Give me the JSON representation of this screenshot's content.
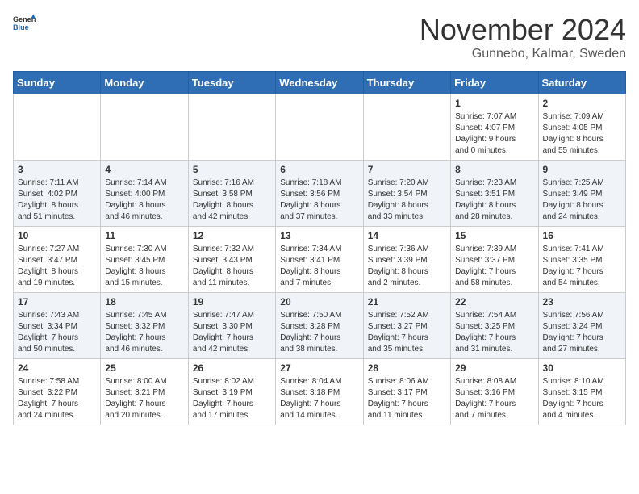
{
  "header": {
    "logo_general": "General",
    "logo_blue": "Blue",
    "month_title": "November 2024",
    "location": "Gunnebo, Kalmar, Sweden"
  },
  "columns": [
    "Sunday",
    "Monday",
    "Tuesday",
    "Wednesday",
    "Thursday",
    "Friday",
    "Saturday"
  ],
  "weeks": [
    [
      {
        "date": "",
        "info": ""
      },
      {
        "date": "",
        "info": ""
      },
      {
        "date": "",
        "info": ""
      },
      {
        "date": "",
        "info": ""
      },
      {
        "date": "",
        "info": ""
      },
      {
        "date": "1",
        "info": "Sunrise: 7:07 AM\nSunset: 4:07 PM\nDaylight: 9 hours\nand 0 minutes."
      },
      {
        "date": "2",
        "info": "Sunrise: 7:09 AM\nSunset: 4:05 PM\nDaylight: 8 hours\nand 55 minutes."
      }
    ],
    [
      {
        "date": "3",
        "info": "Sunrise: 7:11 AM\nSunset: 4:02 PM\nDaylight: 8 hours\nand 51 minutes."
      },
      {
        "date": "4",
        "info": "Sunrise: 7:14 AM\nSunset: 4:00 PM\nDaylight: 8 hours\nand 46 minutes."
      },
      {
        "date": "5",
        "info": "Sunrise: 7:16 AM\nSunset: 3:58 PM\nDaylight: 8 hours\nand 42 minutes."
      },
      {
        "date": "6",
        "info": "Sunrise: 7:18 AM\nSunset: 3:56 PM\nDaylight: 8 hours\nand 37 minutes."
      },
      {
        "date": "7",
        "info": "Sunrise: 7:20 AM\nSunset: 3:54 PM\nDaylight: 8 hours\nand 33 minutes."
      },
      {
        "date": "8",
        "info": "Sunrise: 7:23 AM\nSunset: 3:51 PM\nDaylight: 8 hours\nand 28 minutes."
      },
      {
        "date": "9",
        "info": "Sunrise: 7:25 AM\nSunset: 3:49 PM\nDaylight: 8 hours\nand 24 minutes."
      }
    ],
    [
      {
        "date": "10",
        "info": "Sunrise: 7:27 AM\nSunset: 3:47 PM\nDaylight: 8 hours\nand 19 minutes."
      },
      {
        "date": "11",
        "info": "Sunrise: 7:30 AM\nSunset: 3:45 PM\nDaylight: 8 hours\nand 15 minutes."
      },
      {
        "date": "12",
        "info": "Sunrise: 7:32 AM\nSunset: 3:43 PM\nDaylight: 8 hours\nand 11 minutes."
      },
      {
        "date": "13",
        "info": "Sunrise: 7:34 AM\nSunset: 3:41 PM\nDaylight: 8 hours\nand 7 minutes."
      },
      {
        "date": "14",
        "info": "Sunrise: 7:36 AM\nSunset: 3:39 PM\nDaylight: 8 hours\nand 2 minutes."
      },
      {
        "date": "15",
        "info": "Sunrise: 7:39 AM\nSunset: 3:37 PM\nDaylight: 7 hours\nand 58 minutes."
      },
      {
        "date": "16",
        "info": "Sunrise: 7:41 AM\nSunset: 3:35 PM\nDaylight: 7 hours\nand 54 minutes."
      }
    ],
    [
      {
        "date": "17",
        "info": "Sunrise: 7:43 AM\nSunset: 3:34 PM\nDaylight: 7 hours\nand 50 minutes."
      },
      {
        "date": "18",
        "info": "Sunrise: 7:45 AM\nSunset: 3:32 PM\nDaylight: 7 hours\nand 46 minutes."
      },
      {
        "date": "19",
        "info": "Sunrise: 7:47 AM\nSunset: 3:30 PM\nDaylight: 7 hours\nand 42 minutes."
      },
      {
        "date": "20",
        "info": "Sunrise: 7:50 AM\nSunset: 3:28 PM\nDaylight: 7 hours\nand 38 minutes."
      },
      {
        "date": "21",
        "info": "Sunrise: 7:52 AM\nSunset: 3:27 PM\nDaylight: 7 hours\nand 35 minutes."
      },
      {
        "date": "22",
        "info": "Sunrise: 7:54 AM\nSunset: 3:25 PM\nDaylight: 7 hours\nand 31 minutes."
      },
      {
        "date": "23",
        "info": "Sunrise: 7:56 AM\nSunset: 3:24 PM\nDaylight: 7 hours\nand 27 minutes."
      }
    ],
    [
      {
        "date": "24",
        "info": "Sunrise: 7:58 AM\nSunset: 3:22 PM\nDaylight: 7 hours\nand 24 minutes."
      },
      {
        "date": "25",
        "info": "Sunrise: 8:00 AM\nSunset: 3:21 PM\nDaylight: 7 hours\nand 20 minutes."
      },
      {
        "date": "26",
        "info": "Sunrise: 8:02 AM\nSunset: 3:19 PM\nDaylight: 7 hours\nand 17 minutes."
      },
      {
        "date": "27",
        "info": "Sunrise: 8:04 AM\nSunset: 3:18 PM\nDaylight: 7 hours\nand 14 minutes."
      },
      {
        "date": "28",
        "info": "Sunrise: 8:06 AM\nSunset: 3:17 PM\nDaylight: 7 hours\nand 11 minutes."
      },
      {
        "date": "29",
        "info": "Sunrise: 8:08 AM\nSunset: 3:16 PM\nDaylight: 7 hours\nand 7 minutes."
      },
      {
        "date": "30",
        "info": "Sunrise: 8:10 AM\nSunset: 3:15 PM\nDaylight: 7 hours\nand 4 minutes."
      }
    ]
  ]
}
